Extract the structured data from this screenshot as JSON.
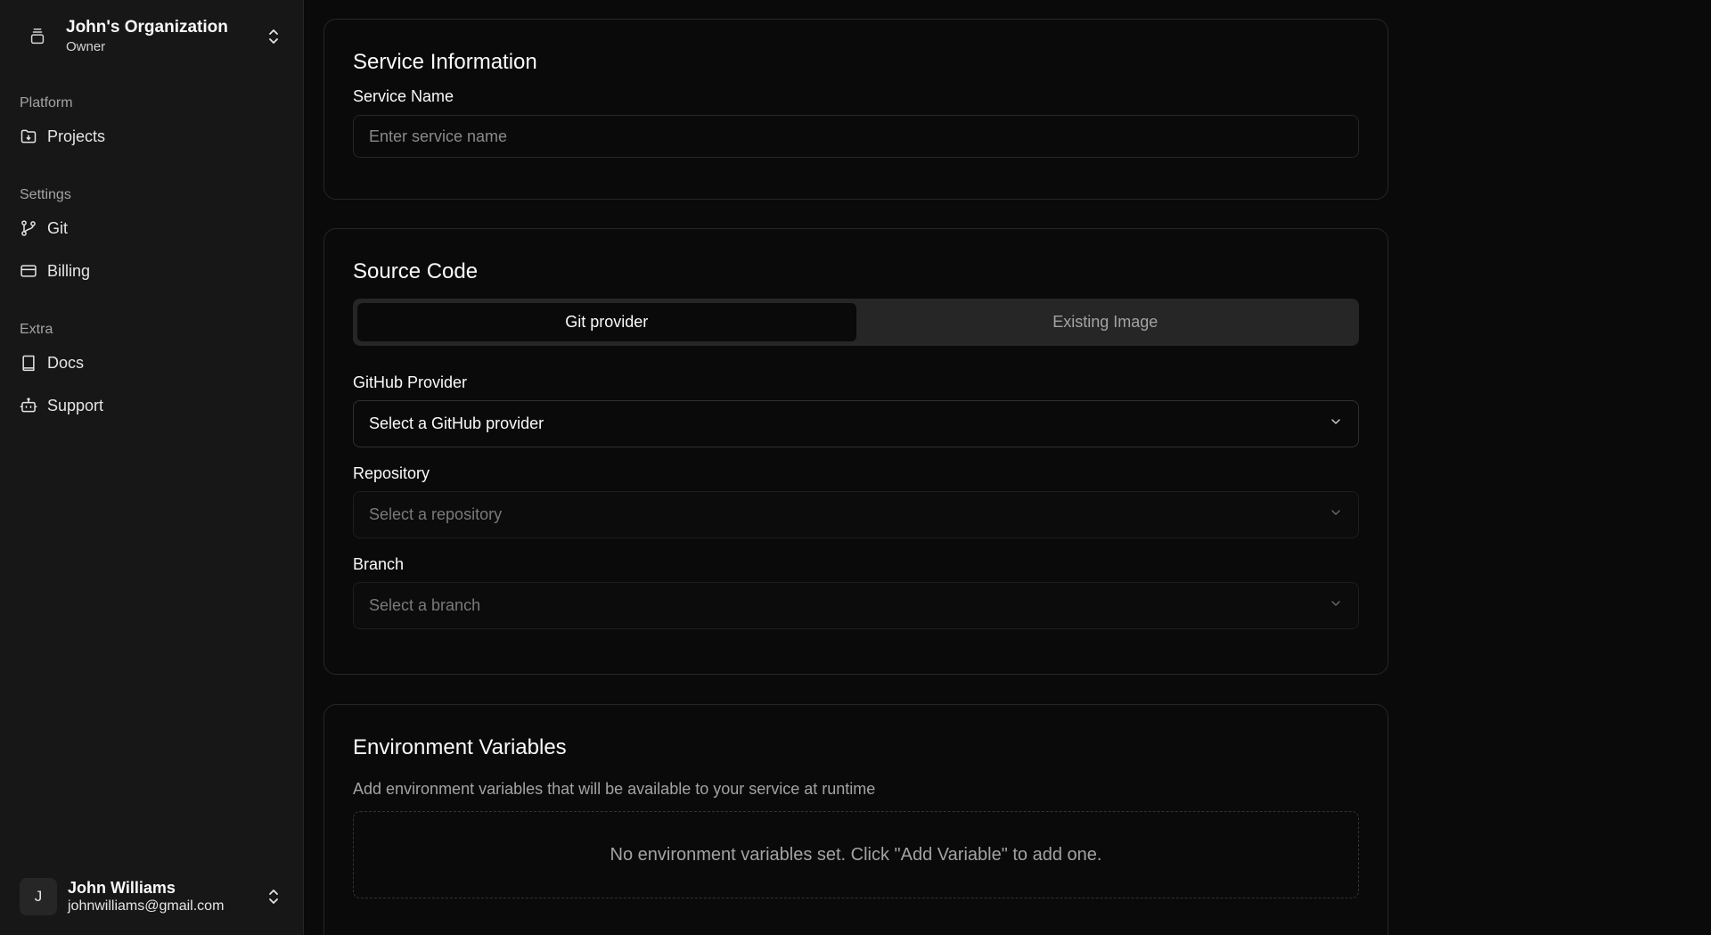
{
  "sidebar": {
    "org": {
      "name": "John's Organization",
      "role": "Owner"
    },
    "groups": [
      {
        "label": "Platform",
        "items": [
          {
            "label": "Projects",
            "icon": "folder-icon"
          }
        ]
      },
      {
        "label": "Settings",
        "items": [
          {
            "label": "Git",
            "icon": "git-branch-icon"
          },
          {
            "label": "Billing",
            "icon": "credit-card-icon"
          }
        ]
      },
      {
        "label": "Extra",
        "items": [
          {
            "label": "Docs",
            "icon": "book-icon"
          },
          {
            "label": "Support",
            "icon": "bot-icon"
          }
        ]
      }
    ],
    "user": {
      "initial": "J",
      "name": "John Williams",
      "email": "johnwilliams@gmail.com"
    }
  },
  "service_info": {
    "title": "Service Information",
    "name_label": "Service Name",
    "name_placeholder": "Enter service name",
    "name_value": ""
  },
  "source_code": {
    "title": "Source Code",
    "tabs": [
      {
        "label": "Git provider",
        "active": true
      },
      {
        "label": "Existing Image",
        "active": false
      }
    ],
    "provider_label": "GitHub Provider",
    "provider_value": "Select a GitHub provider",
    "repo_label": "Repository",
    "repo_value": "Select a repository",
    "branch_label": "Branch",
    "branch_value": "Select a branch"
  },
  "env_vars": {
    "title": "Environment Variables",
    "description": "Add environment variables that will be available to your service at runtime",
    "empty_text": "No environment variables set. Click \"Add Variable\" to add one."
  },
  "colors": {
    "background": "#0a0a0a",
    "sidebar": "#171717",
    "border": "#262626",
    "text": "#fafafa",
    "muted": "#a3a3a3"
  }
}
